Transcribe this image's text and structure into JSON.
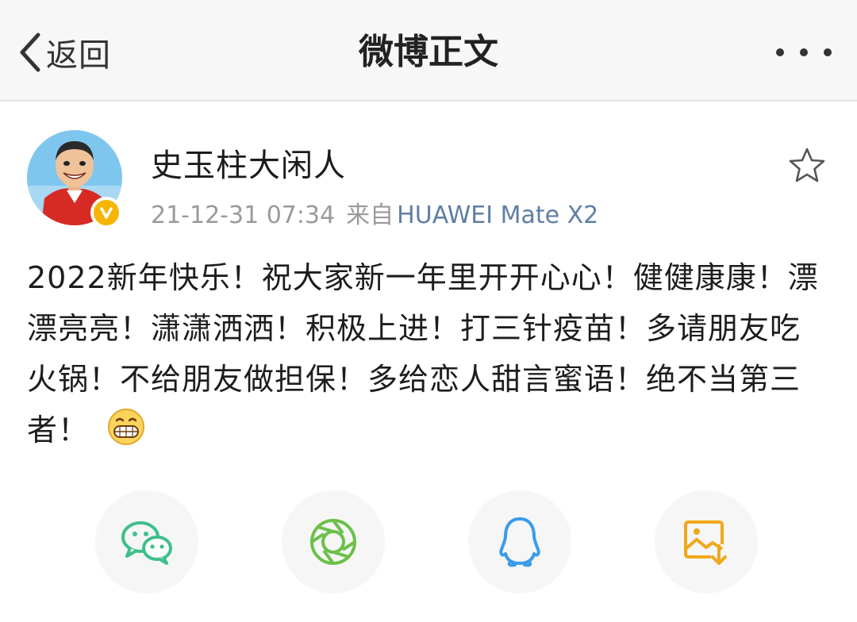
{
  "navbar": {
    "back_label": "返回",
    "title": "微博正文",
    "more_icon": "more-dots-icon"
  },
  "post": {
    "author": "史玉柱大闲人",
    "verified": true,
    "timestamp": "21-12-31 07:34",
    "from_label": "来自",
    "source": "HUAWEI Mate X2",
    "text": "2022新年快乐！祝大家新一年里开开心心！健健康康！漂漂亮亮！潇潇洒洒！积极上进！打三针疫苗！多请朋友吃火锅！不给朋友做担保！多给恋人甜言蜜语！绝不当第三者！",
    "emoji": "grinning-emoji"
  },
  "share": {
    "items": [
      {
        "icon": "wechat-icon",
        "color": "#3fbf8a"
      },
      {
        "icon": "moments-icon",
        "color": "#6cc04a"
      },
      {
        "icon": "qq-icon",
        "color": "#3a9be8"
      },
      {
        "icon": "save-image-icon",
        "color": "#f0a81a"
      }
    ]
  },
  "colors": {
    "source_link": "#5f7ea6",
    "verified_badge": "#f6b500",
    "meta_text": "#9a9a9a"
  }
}
